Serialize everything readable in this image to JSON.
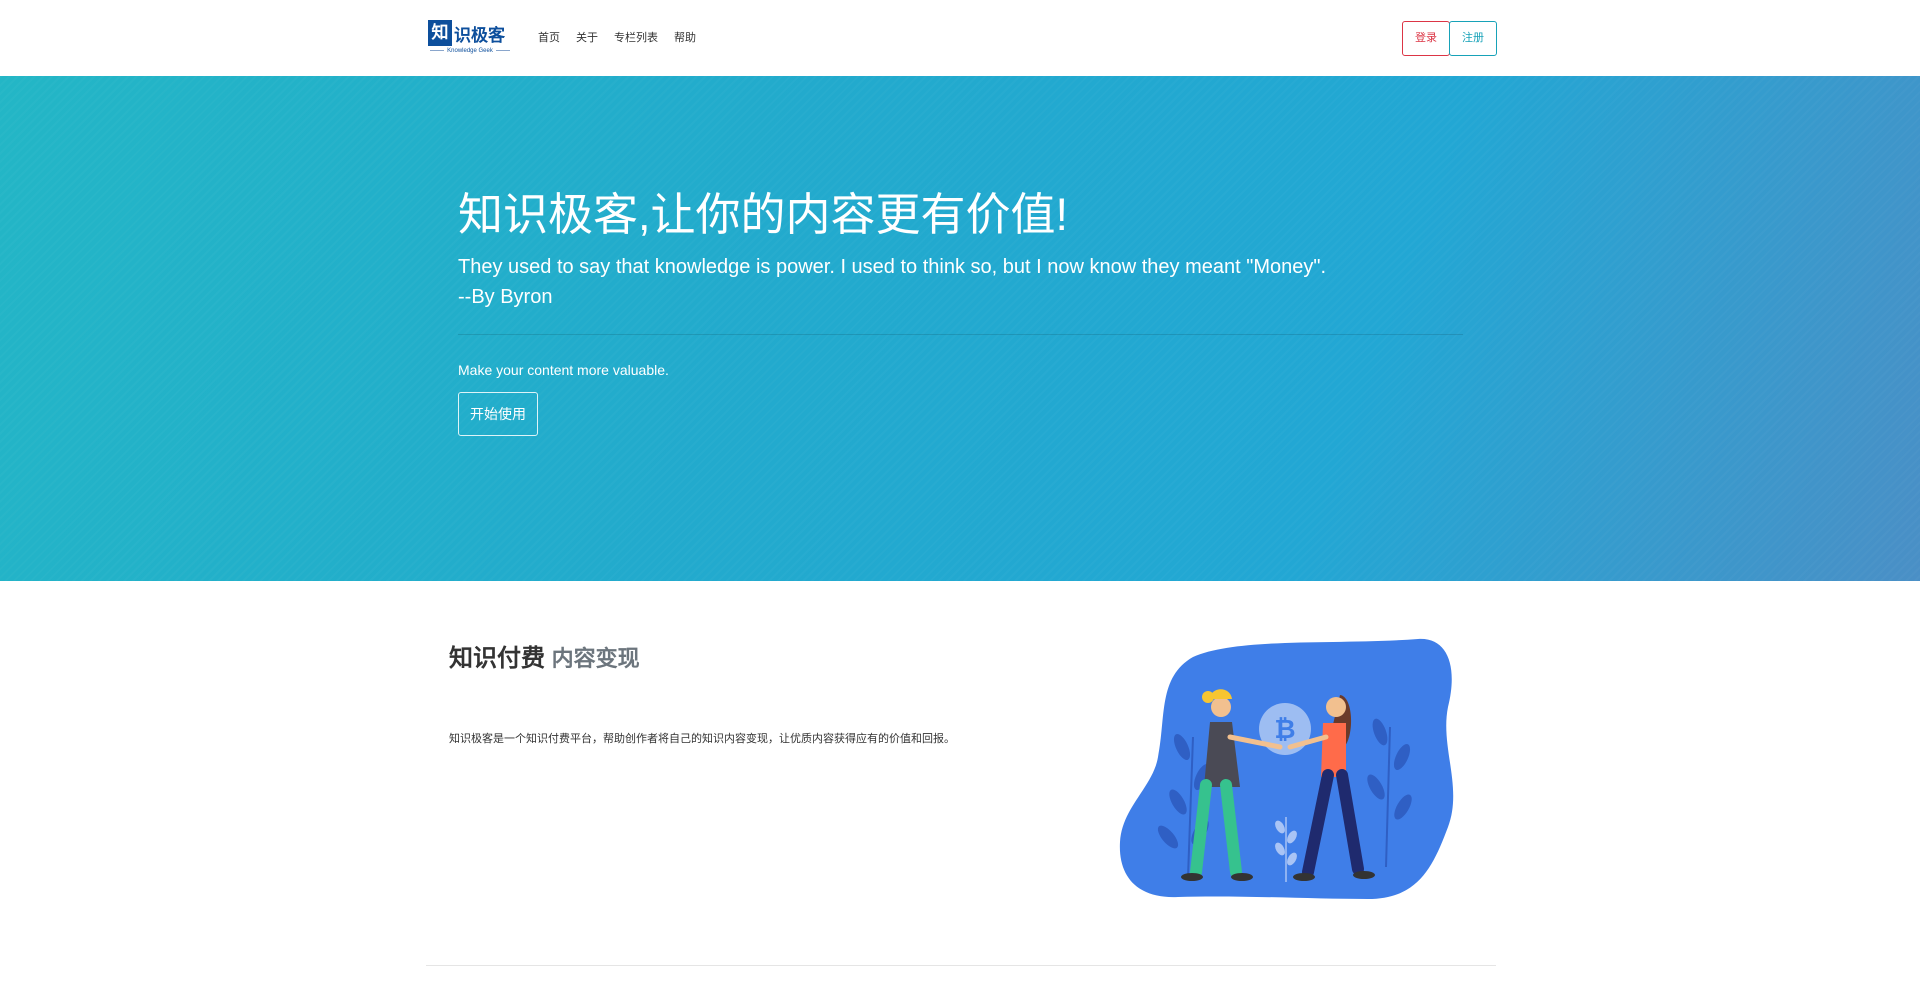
{
  "brand": {
    "logo_char": "知",
    "logo_text": "识极客",
    "logo_subtitle": "Knowledge Geek"
  },
  "nav": {
    "links": [
      "首页",
      "关于",
      "专栏列表",
      "帮助"
    ],
    "login_label": "登录",
    "register_label": "注册"
  },
  "hero": {
    "title": "知识极客,让你的内容更有价值!",
    "quote": "They used to say that knowledge is power. I used to think so, but I now know they meant \"Money\".",
    "quote_author": "--By Byron",
    "lead": "Make your content more valuable.",
    "button_label": "开始使用"
  },
  "feature": {
    "heading": "知识付费",
    "heading_muted": "内容变现",
    "lead": "知识极客是一个知识付费平台，帮助创作者将自己的知识内容变现，让优质内容获得应有的价值和回报。"
  },
  "colors": {
    "brand_blue": "#0d4f9c",
    "hero_start": "#23b6c6",
    "hero_end": "#4a8fc6",
    "btn_red": "#dc3545",
    "btn_blue": "#17a2b8",
    "illustration_blue": "#3f7ee8"
  }
}
